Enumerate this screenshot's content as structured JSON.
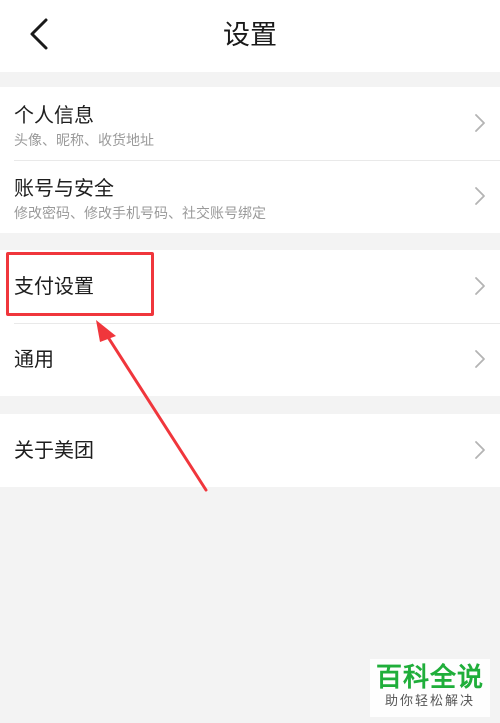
{
  "header": {
    "title": "设置",
    "back_icon": "chevron-left-icon"
  },
  "groups": [
    {
      "rows": [
        {
          "title": "个人信息",
          "subtitle": "头像、昵称、收货地址"
        },
        {
          "title": "账号与安全",
          "subtitle": "修改密码、修改手机号码、社交账号绑定"
        }
      ]
    },
    {
      "rows": [
        {
          "title": "支付设置"
        },
        {
          "title": "通用"
        }
      ]
    },
    {
      "rows": [
        {
          "title": "关于美团"
        }
      ]
    }
  ],
  "annotation": {
    "color": "#f0363c"
  },
  "watermark": {
    "main": "百科全说",
    "sub": "助你轻松解决",
    "color": "#1fae3a"
  },
  "colors": {
    "background": "#f3f3f3",
    "surface": "#ffffff",
    "text_primary": "#1e1e1e",
    "text_secondary": "#9a9a9a",
    "chevron": "#b4b4b4"
  }
}
